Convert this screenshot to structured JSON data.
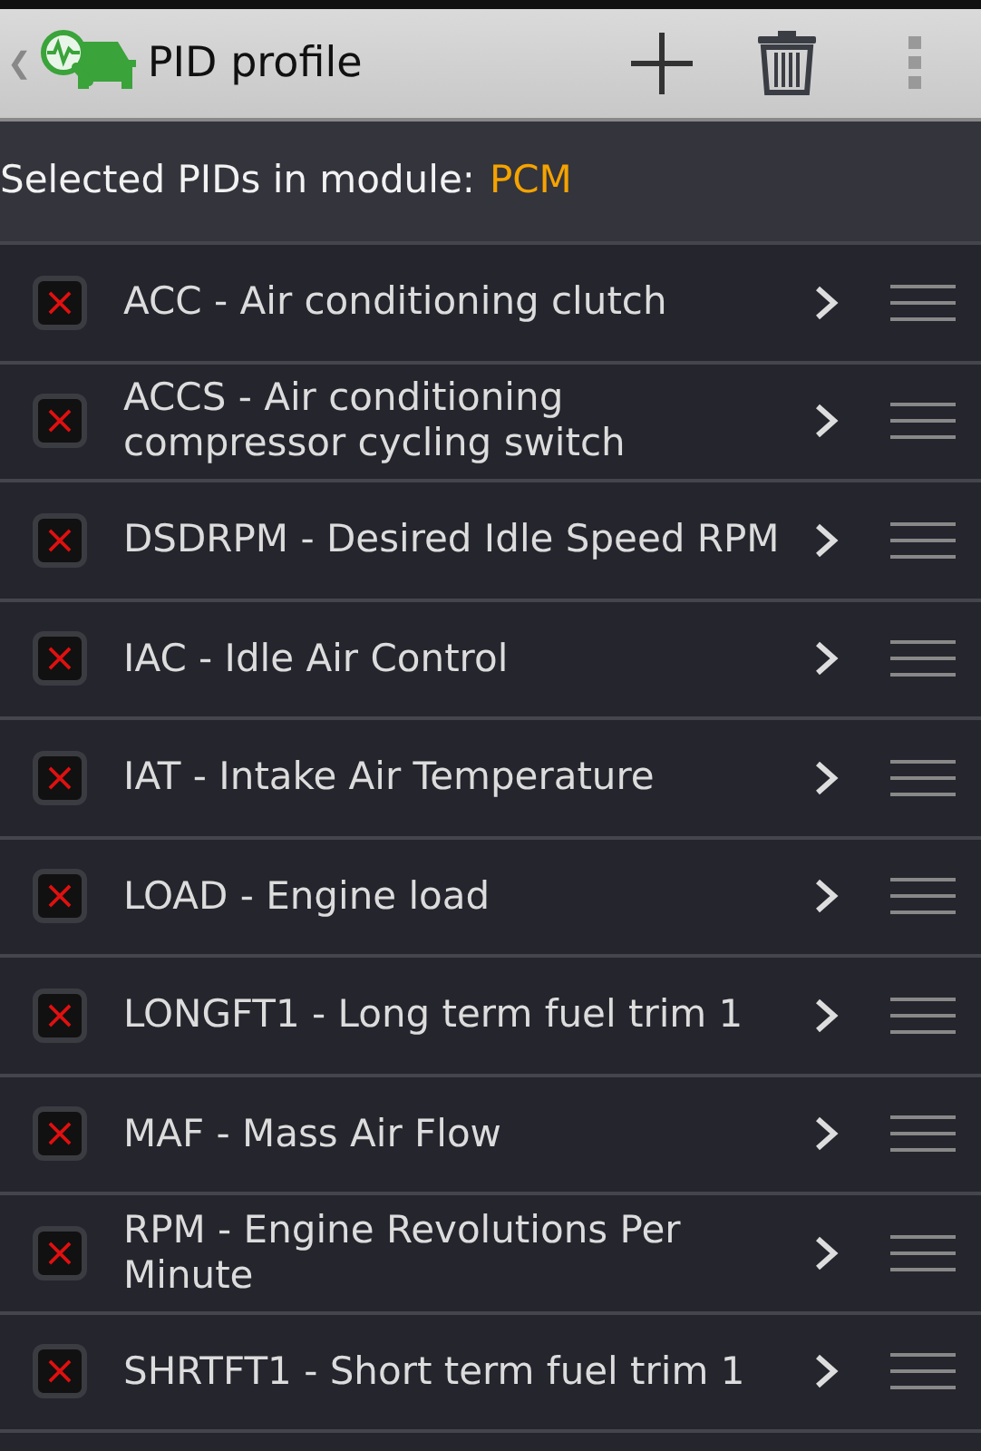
{
  "action_bar": {
    "back": "❮",
    "title": "PID profile"
  },
  "header": {
    "label": "Selected PIDs in module:",
    "module": "PCM"
  },
  "pids": [
    {
      "label": "ACC - Air conditioning clutch",
      "checked": true
    },
    {
      "label": "ACCS - Air conditioning compressor cycling switch",
      "checked": true
    },
    {
      "label": "DSDRPM - Desired Idle Speed RPM",
      "checked": true
    },
    {
      "label": "IAC - Idle Air Control",
      "checked": true
    },
    {
      "label": "IAT - Intake Air Temperature",
      "checked": true
    },
    {
      "label": "LOAD - Engine load",
      "checked": true
    },
    {
      "label": "LONGFT1 - Long term fuel trim 1",
      "checked": true
    },
    {
      "label": "MAF - Mass Air Flow",
      "checked": true
    },
    {
      "label": "RPM - Engine Revolutions Per Minute",
      "checked": true
    },
    {
      "label": "SHRTFT1 - Short term fuel trim 1",
      "checked": true
    }
  ]
}
